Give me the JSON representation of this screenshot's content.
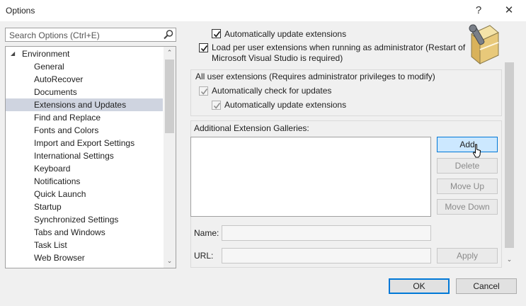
{
  "window": {
    "title": "Options",
    "help_glyph": "?",
    "close_glyph": "✕"
  },
  "search": {
    "placeholder": "Search Options (Ctrl+E)"
  },
  "tree": {
    "root": "Environment",
    "items": [
      "General",
      "AutoRecover",
      "Documents",
      "Extensions and Updates",
      "Find and Replace",
      "Fonts and Colors",
      "Import and Export Settings",
      "International Settings",
      "Keyboard",
      "Notifications",
      "Quick Launch",
      "Startup",
      "Synchronized Settings",
      "Tabs and Windows",
      "Task List",
      "Web Browser"
    ],
    "selected": "Extensions and Updates",
    "collapse_glyph": "◢",
    "scroll_up_glyph": "⌃",
    "scroll_down_glyph": "⌄"
  },
  "panel": {
    "auto_update_label": "Automatically update extensions",
    "load_per_user_line1": "Load per user extensions when running as administrator (Restart of",
    "load_per_user_line2": "Microsoft Visual Studio is required)",
    "all_users_heading": "All user extensions (Requires administrator privileges to modify)",
    "all_check_updates_label": "Automatically check for updates",
    "all_auto_update_label": "Automatically update extensions",
    "galleries_label": "Additional Extension Galleries:",
    "name_label": "Name:",
    "url_label": "URL:",
    "add_button": "Add",
    "delete_button": "Delete",
    "move_up_button": "Move Up",
    "move_down_button": "Move Down",
    "apply_button": "Apply",
    "scroll_down_glyph": "⌄"
  },
  "footer": {
    "ok_button": "OK",
    "cancel_button": "Cancel"
  }
}
